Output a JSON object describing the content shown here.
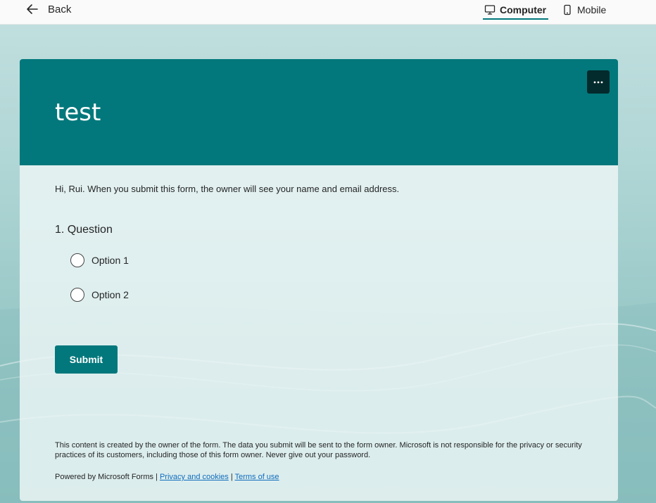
{
  "topbar": {
    "back_label": "Back",
    "view_modes": {
      "computer": "Computer",
      "mobile": "Mobile"
    }
  },
  "form": {
    "title": "test",
    "notice": "Hi, Rui. When you submit this form, the owner will see your name and email address.",
    "question": {
      "number": "1.",
      "title": "Question",
      "options": [
        "Option 1",
        "Option 2"
      ]
    },
    "submit_label": "Submit",
    "disclaimer": "This content is created by the owner of the form. The data you submit will be sent to the form owner. Microsoft is not responsible for the privacy or security practices of its customers, including those of this form owner. Never give out your password.",
    "footer": {
      "powered_by": "Powered by Microsoft Forms",
      "separator": "|",
      "privacy_link": "Privacy and cookies",
      "terms_link": "Terms of use"
    }
  },
  "colors": {
    "accent": "#03787c",
    "more_button": "#032a2c"
  },
  "icons": {
    "back": "arrow-left-icon",
    "computer": "monitor-icon",
    "mobile": "phone-icon",
    "more": "more-horizontal-icon"
  }
}
